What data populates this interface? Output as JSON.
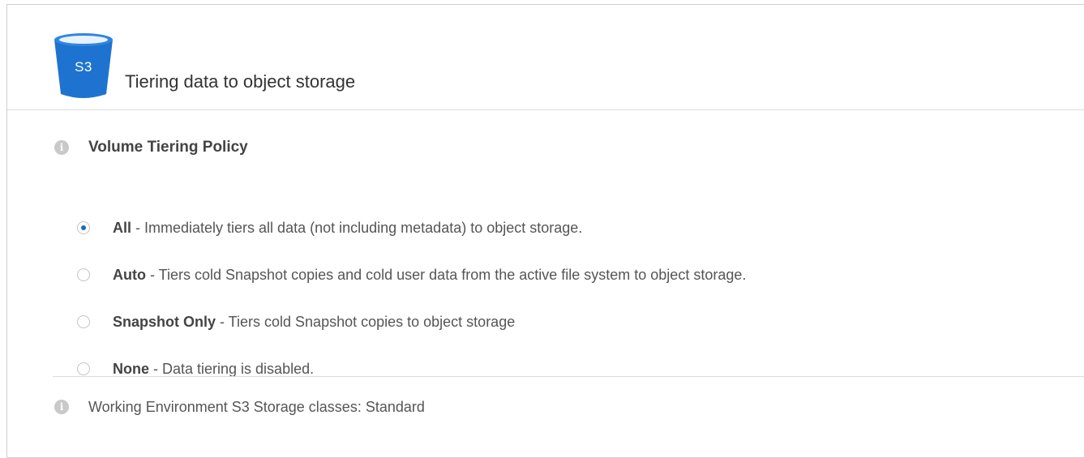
{
  "header": {
    "icon_label": "S3",
    "title": "Tiering data to object storage"
  },
  "policy": {
    "title": "Volume Tiering Policy",
    "options": [
      {
        "name": "All",
        "description": " - Immediately tiers all data (not including metadata) to object storage.",
        "selected": true
      },
      {
        "name": "Auto",
        "description": " - Tiers cold Snapshot copies and cold user data from the active file system to object storage.",
        "selected": false
      },
      {
        "name": "Snapshot Only",
        "description": " - Tiers cold Snapshot copies to object storage",
        "selected": false
      },
      {
        "name": "None",
        "description": " - Data tiering is disabled.",
        "selected": false
      }
    ]
  },
  "footer": {
    "text": "Working Environment S3 Storage classes: Standard"
  },
  "colors": {
    "bucket": "#1f73d0",
    "radio_selected": "#1e6ab8",
    "info_icon": "#c9c9c9"
  },
  "icons": {
    "bucket": "s3-bucket-icon",
    "info": "info-icon"
  }
}
